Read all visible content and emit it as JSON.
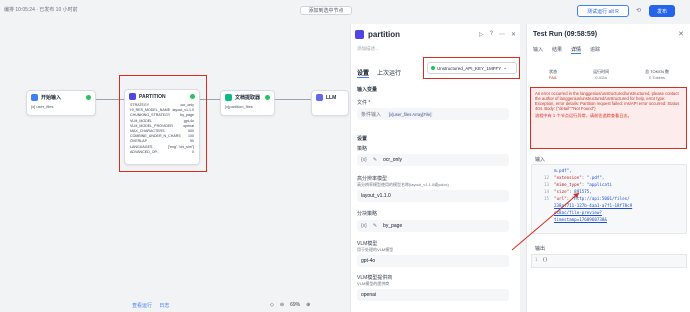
{
  "topbar": {
    "status": "编排 10:05:24 · 已发布 10 小时前",
    "add_node": "添加到选中节点",
    "run_label": "测试运行 alt R",
    "publish_label": "发布"
  },
  "nodes": {
    "start": {
      "title": "开始输入",
      "sub": "[x] user_files"
    },
    "partition": {
      "title": "PARTITION",
      "params": [
        [
          "STRATEGY",
          "ocr_only"
        ],
        [
          "HI_RES_MODEL_NAME",
          "layout_v1.1.0"
        ],
        [
          "CHUNKING_STRATEGY",
          "by_page"
        ],
        [
          "VLM_MODEL",
          "gpt-4o"
        ],
        [
          "VLM_MODEL_PROVIDER",
          "openai"
        ],
        [
          "MAX_CHARACTERS",
          "500"
        ],
        [
          "COMBINE_UNDER_N_CHARS",
          "100"
        ],
        [
          "OVERLAP",
          "50"
        ],
        [
          "LANGUAGES",
          "[\"eng\",\"chi_sim\"]"
        ],
        [
          "ADVANCED_OP...",
          "0"
        ]
      ]
    },
    "doc": {
      "title": "文档提取器",
      "sub": "[x]partition_files"
    },
    "llm": {
      "title": "LLM"
    }
  },
  "bottom": {
    "link1": "查看运行",
    "link2": "日志",
    "zoom": "69%"
  },
  "panel": {
    "title": "partition",
    "desc": "添加描述...",
    "tabs": [
      "设置",
      "上次运行"
    ],
    "credential": "Unstructured_API_KEY_1MFFY",
    "input_section": "输入变量",
    "file_label": "文件 *",
    "file_value": "[x]user_files Array[File]",
    "file_prefix": "条件输入",
    "settings_section": "设置",
    "strategy_label": "策略",
    "strategy_value": "ocr_only",
    "hires_label": "高分辨率模型",
    "hires_desc": "高分辨率模型使用的模型名称(layout_v1.1.0或yolox)",
    "hires_value": "layout_v1.1.0",
    "chunk_label": "分块策略",
    "chunk_value": "by_page",
    "vlm_label": "VLM模型",
    "vlm_desc": "用于处理的VLM模型",
    "vlm_value": "gpt-4o",
    "vlmp_label": "VLM模型提供商",
    "vlmp_desc": "VLM模型的提供商",
    "vlmp_value": "openai"
  },
  "run": {
    "title": "Test Run (09:58:59)",
    "tabs": [
      "输入",
      "结果",
      "详情",
      "追踪"
    ],
    "active_tab": "详情",
    "stats": [
      {
        "label": "状态",
        "value": "FAIL"
      },
      {
        "label": "运行时间",
        "value": "0.411s"
      },
      {
        "label": "总 TOKEN 数",
        "value": "0 Tokens"
      }
    ],
    "error": "An error occurred in the langgenius/unstructured/unstructured, please contact the author of langgenius/unstructured/unstructured for help, error type: Exception, error details: Partition request failed: ms/API error occurred: Status 404. Body: {\"detail\":\"Not Found\"}",
    "error_hint": "流程中有 1 个节点运行异常，请前往追踪查看日志。",
    "input_label": "输入",
    "code_lines": [
      {
        "no": "",
        "text": "m.pdf\","
      },
      {
        "no": "12",
        "key": "\"extension\"",
        "val": "\".pdf\","
      },
      {
        "no": "13",
        "key": "\"mime_type\"",
        "val": "\"applicati"
      },
      {
        "no": "14",
        "key": "\"size\"",
        "val": "891575,"
      },
      {
        "no": "15",
        "key": "\"url\"",
        "val": "\"http://api:5001/files/"
      },
      {
        "no": "",
        "text": "238af711-127b-4aa1-a7f1-18f78c9"
      },
      {
        "no": "",
        "text": "cc8ac/file-preview?"
      },
      {
        "no": "",
        "text": "timestamp=1760960738&"
      }
    ],
    "output_label": "输出",
    "output_line_no": "1",
    "output_text": "{}"
  },
  "colors": {
    "accent": "#2563eb",
    "error": "#d92d20",
    "success": "#22c55e",
    "node_purple": "#4f46e5"
  }
}
